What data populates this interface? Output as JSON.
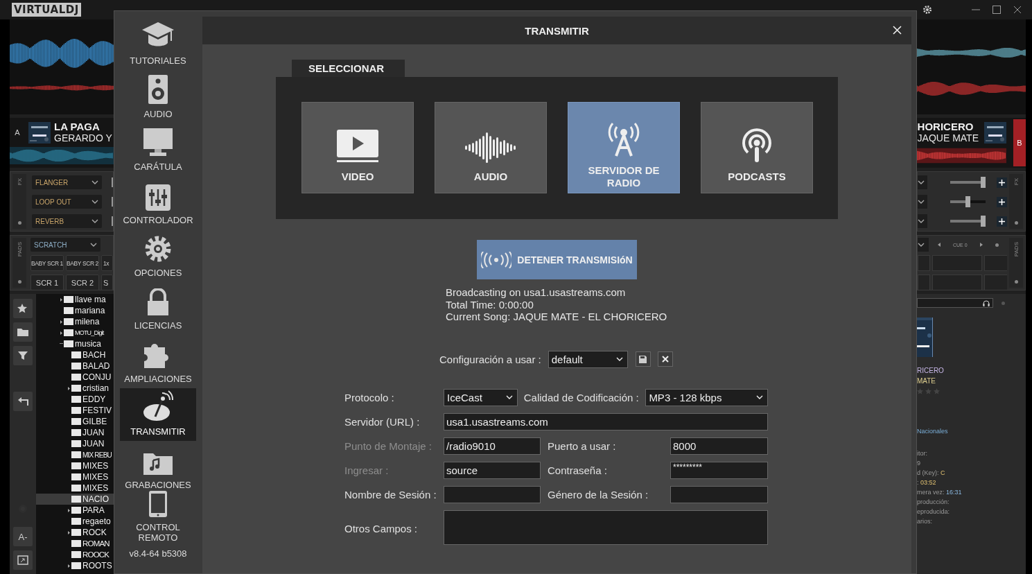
{
  "app": {
    "logo": "VIRTUALDJ"
  },
  "deck_a": {
    "letter": "A",
    "title": "LA PAGA",
    "artist": "GERARDO Y",
    "fx_label": "FX",
    "effects": [
      "FLANGER",
      "LOOP OUT",
      "REVERB"
    ],
    "pads_label": "PADS",
    "pads_mode": "SCRATCH",
    "pads": [
      [
        "BABY SCR 1",
        "BABY SCR 2",
        "1x"
      ],
      [
        "SCR 1",
        "SCR 2",
        "S"
      ]
    ]
  },
  "browser": {
    "font_button": "A-",
    "folders": [
      {
        "name": "llave ma",
        "expandable": true,
        "selected": false
      },
      {
        "name": "mariana",
        "expandable": false,
        "selected": false
      },
      {
        "name": "milena",
        "expandable": true,
        "selected": false
      },
      {
        "name": "MOTU_Digit",
        "expandable": true,
        "selected": false
      },
      {
        "name": "musica",
        "expandable": true,
        "selected": false,
        "children": [
          {
            "name": "BACH",
            "expandable": false,
            "selected": false
          },
          {
            "name": "BALAD",
            "expandable": false,
            "selected": false
          },
          {
            "name": "CONJU",
            "expandable": false,
            "selected": false
          },
          {
            "name": "cristian",
            "expandable": true,
            "selected": false
          },
          {
            "name": "EDDY",
            "expandable": false,
            "selected": false
          },
          {
            "name": "FESTIV",
            "expandable": false,
            "selected": false
          },
          {
            "name": "GILBE",
            "expandable": false,
            "selected": false
          },
          {
            "name": "JUAN",
            "expandable": false,
            "selected": false
          },
          {
            "name": "JUAN",
            "expandable": false,
            "selected": false
          },
          {
            "name": "MIX REBU",
            "expandable": false,
            "selected": false
          },
          {
            "name": "MIXES",
            "expandable": false,
            "selected": false
          },
          {
            "name": "MIXES",
            "expandable": false,
            "selected": false
          },
          {
            "name": "MIXES",
            "expandable": false,
            "selected": false
          },
          {
            "name": "NACIO",
            "expandable": false,
            "selected": true
          },
          {
            "name": "PARA",
            "expandable": true,
            "selected": false
          },
          {
            "name": "regaeto",
            "expandable": false,
            "selected": false
          },
          {
            "name": "ROCK",
            "expandable": true,
            "selected": false
          },
          {
            "name": "ROMAN",
            "expandable": false,
            "selected": false
          },
          {
            "name": "ROOCK",
            "expandable": false,
            "selected": false
          },
          {
            "name": "ROOTS",
            "expandable": true,
            "selected": false
          }
        ]
      }
    ]
  },
  "deck_b": {
    "letter": "B",
    "title": "HORICERO",
    "artist": "JAQUE MATE",
    "fx_sliders": [
      {
        "level": 1.0
      },
      {
        "level": 0.5
      },
      {
        "level": 1.0
      }
    ],
    "fx_label": "FX",
    "cue": "CUE 0",
    "pads_label": "PADS"
  },
  "song_info": {
    "title": "RICERO",
    "artist": "MATE",
    "stars": 0,
    "genre": "Nacionales",
    "rows": [
      {
        "label": "itor:"
      },
      {
        "label": "9"
      },
      {
        "label": "d (Key):",
        "value": "C"
      },
      {
        "label": ":",
        "value": "03:52"
      },
      {
        "label": "mera vez:",
        "value": "16:31"
      },
      {
        "label": "producción:"
      },
      {
        "label": "eproducida:"
      },
      {
        "label": "arios:"
      }
    ]
  },
  "dialog": {
    "title": "TRANSMITIR",
    "version": "v8.4-64 b5308",
    "sidebar": [
      {
        "label": "TUTORIALES",
        "selected": false
      },
      {
        "label": "AUDIO",
        "selected": false
      },
      {
        "label": "CARÁTULA",
        "selected": false
      },
      {
        "label": "CONTROLADOR",
        "selected": false
      },
      {
        "label": "OPCIONES",
        "selected": false
      },
      {
        "label": "LICENCIAS",
        "selected": false
      },
      {
        "label": "AMPLIACIONES",
        "selected": false
      },
      {
        "label": "TRANSMITIR",
        "selected": true
      },
      {
        "label": "GRABACIONES",
        "selected": false
      },
      {
        "label": "CONTROL REMOTO",
        "selected": false
      }
    ],
    "tab": "SELECCIONAR",
    "options": [
      {
        "label": "VIDEO",
        "selected": false
      },
      {
        "label": "AUDIO",
        "selected": false
      },
      {
        "label": "SERVIDOR DE RADIO",
        "selected": true
      },
      {
        "label": "PODCASTS",
        "selected": false
      }
    ],
    "stop_button": "DETENER TRANSMISIóN",
    "status": [
      "Broadcasting on usa1.usastreams.com",
      "Total Time: 0:00:00",
      "Current Song: JAQUE MATE - EL CHORICERO"
    ],
    "config": {
      "label": "Configuración a usar :",
      "value": "default"
    },
    "form": {
      "protocol": {
        "label": "Protocolo :",
        "value": "IceCast",
        "disabled": false
      },
      "quality": {
        "label": "Calidad de Codificación :",
        "value": "MP3 - 128 kbps"
      },
      "server": {
        "label": "Servidor (URL) :",
        "value": "usa1.usastreams.com",
        "disabled": false
      },
      "mount": {
        "label": "Punto de Montaje :",
        "value": "/radio9010",
        "disabled": true
      },
      "port": {
        "label": "Puerto a usar :",
        "value": "8000"
      },
      "login": {
        "label": "Ingresar :",
        "value": "source",
        "disabled": true
      },
      "password": {
        "label": "Contraseña :",
        "value": "*********"
      },
      "session_name": {
        "label": "Nombre de Sesión :",
        "disabled": false
      },
      "session_genre": {
        "label": "Género de la Sesión :"
      },
      "other": {
        "label": "Otros Campos :",
        "disabled": false
      }
    }
  }
}
